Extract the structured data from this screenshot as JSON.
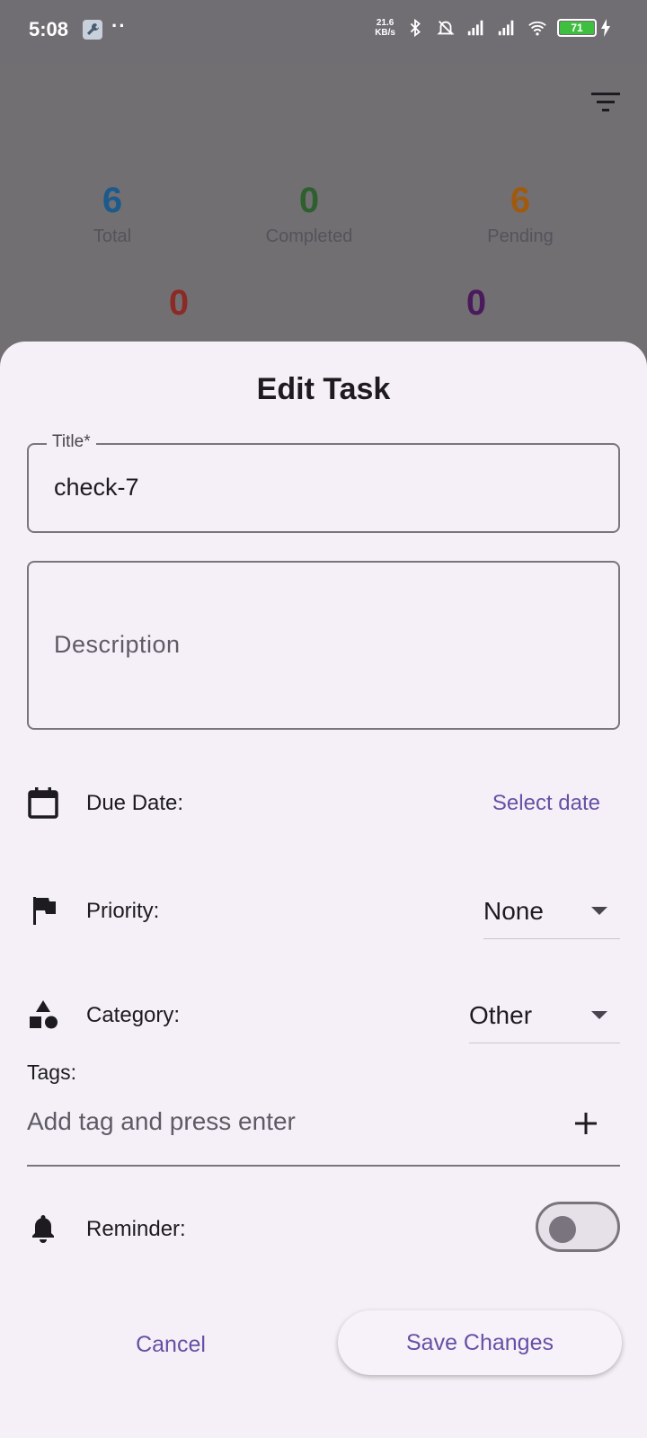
{
  "status_bar": {
    "time": "5:08",
    "dots": "··",
    "speed_value": "21.6",
    "speed_unit": "KB/s",
    "battery": "71"
  },
  "stats": {
    "total": {
      "value": "6",
      "label": "Total",
      "color": "#1c5a8c"
    },
    "completed": {
      "value": "0",
      "label": "Completed",
      "color": "#2e5f2e"
    },
    "pending": {
      "value": "6",
      "label": "Pending",
      "color": "#a05a10"
    },
    "fourth": {
      "value": "0",
      "color": "#8c2a25"
    },
    "fifth": {
      "value": "0",
      "color": "#4a1a5c"
    }
  },
  "dialog": {
    "title": "Edit Task",
    "title_field": {
      "label": "Title*",
      "value": "check-7"
    },
    "description_field": {
      "placeholder": "Description"
    },
    "due_date": {
      "label": "Due Date:",
      "action": "Select date",
      "icon": "calendar-icon"
    },
    "priority": {
      "label": "Priority:",
      "value": "None",
      "icon": "flag-icon"
    },
    "category": {
      "label": "Category:",
      "value": "Other",
      "icon": "category-icon"
    },
    "tags": {
      "label": "Tags:",
      "placeholder": "Add tag and press enter",
      "icon": "add-icon"
    },
    "reminder": {
      "label": "Reminder:",
      "enabled": false,
      "icon": "bell-icon"
    },
    "cancel_label": "Cancel",
    "save_label": "Save Changes"
  },
  "colors": {
    "accent": "#6750a4",
    "sheet_bg": "#f5f0f7",
    "scrim_bg": "#716e73"
  }
}
